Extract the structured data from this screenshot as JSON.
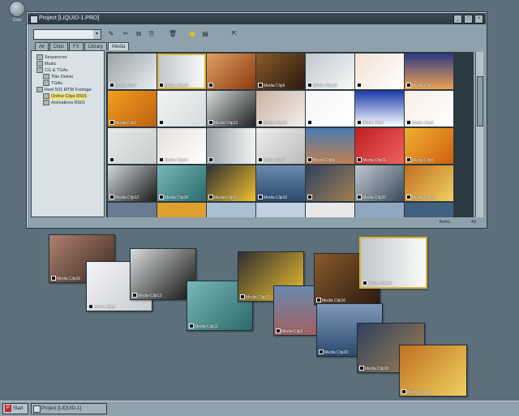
{
  "desktop": {
    "icon_label": "Core"
  },
  "window": {
    "title": "Project [LIQUID-1.PRO]",
    "buttons": [
      "_",
      "□",
      "×"
    ]
  },
  "toolbar": {
    "search_value": "",
    "combo_arrow": "▾",
    "tools": [
      {
        "icon": "magic-wand-icon",
        "glyph": "✎"
      },
      {
        "icon": "cut-icon",
        "glyph": "✂"
      },
      {
        "icon": "copy-icon",
        "glyph": "⧉"
      },
      {
        "icon": "paste-icon",
        "glyph": "⎘"
      },
      {
        "icon": "trash-icon",
        "glyph": "🗑"
      },
      {
        "icon": "thumbnail-view-icon",
        "glyph": "▦"
      },
      {
        "icon": "list-view-icon",
        "glyph": "▤"
      },
      {
        "icon": "edit-icon",
        "glyph": "⇱"
      }
    ]
  },
  "tabs": [
    "All",
    "Clips",
    "FX",
    "Library",
    "Media"
  ],
  "active_tab": "Media",
  "tree": [
    {
      "label": "Sequences",
      "indent": 0
    },
    {
      "label": "Music",
      "indent": 0
    },
    {
      "label": "CG & TGAs",
      "indent": 0
    },
    {
      "label": "Title Dekos",
      "indent": 1
    },
    {
      "label": "TGAs",
      "indent": 1
    },
    {
      "label": "Reel 501 MTM Footage",
      "indent": 0
    },
    {
      "label": "Online Clips R501",
      "indent": 1,
      "selected": true
    },
    {
      "label": "Animations R501",
      "indent": 1
    }
  ],
  "grid_labels": [
    "Media Clip7",
    "Media Clip19",
    "",
    "Media Clip6",
    "Media Clip10",
    "",
    "Media Clip1",
    "Media Clip2",
    "",
    "Media Clip13",
    "Media Clip15",
    "",
    "Media Clip4",
    "Media Clip8",
    "",
    "Media Clip14",
    "",
    "Media Clip3",
    "Media Clip9",
    "Media Clip11",
    "Media Clip5",
    "Media Clip12",
    "Media Clip18",
    "Media Clip17",
    "Media Clip16",
    "",
    "Media Clip20",
    "Media Clip21"
  ],
  "status": {
    "items_label": "Items",
    "items_count": "49"
  },
  "floating_labels": [
    "Media Clip16",
    "Media Clip1",
    "Media Clip13",
    "Media Clip11",
    "Media Clip17",
    "Media Clip2",
    "Media Clip10",
    "Media Clip20",
    "Media Clip19",
    "Media Clip18",
    "Media Clip21"
  ],
  "taskbar": {
    "start_label": "Start",
    "start_logo": "P",
    "task_label": "Project [LIQUID-1]"
  }
}
